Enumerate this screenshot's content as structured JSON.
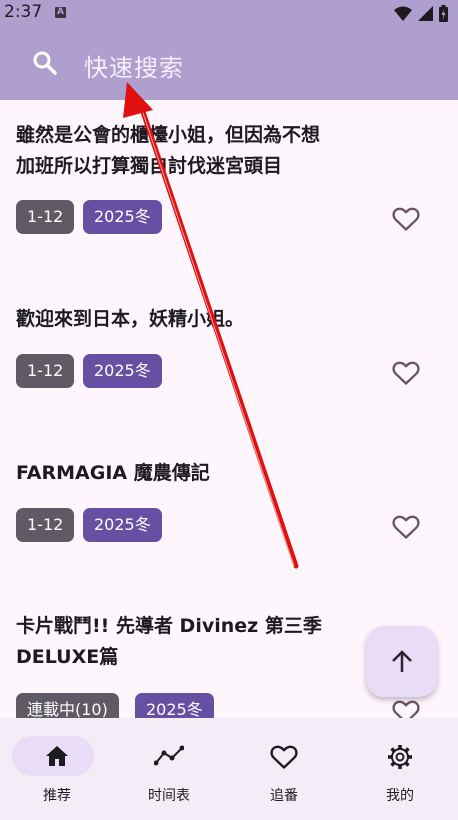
{
  "status": {
    "time": "2:37",
    "a_badge": "A"
  },
  "search": {
    "placeholder": "快速搜索"
  },
  "items": [
    {
      "title": "雖然是公會的櫃檯小姐，但因為不想加班所以打算獨自討伐迷宮頭目",
      "episodes": "1-12",
      "season": "2025冬"
    },
    {
      "title": "歡迎來到日本，妖精小姐。",
      "episodes": "1-12",
      "season": "2025冬"
    },
    {
      "title": "FARMAGIA 魔農傳記",
      "episodes": "1-12",
      "season": "2025冬"
    },
    {
      "title": "卡片戰鬥!! 先導者 Divinez 第三季 DELUXE篇",
      "episodes": "連載中(10)",
      "season": "2025冬"
    }
  ],
  "nav": [
    {
      "label": "推荐",
      "icon": "home-icon"
    },
    {
      "label": "时间表",
      "icon": "timeline-icon"
    },
    {
      "label": "追番",
      "icon": "heart-icon"
    },
    {
      "label": "我的",
      "icon": "gear-icon"
    }
  ],
  "colors": {
    "header": "#ae9fcf",
    "chip_grey": "#5f5a66",
    "chip_purple": "#6750a4",
    "background": "#fdf7fd",
    "navbar": "#f3edf7",
    "annotation_arrow": "#e01010"
  }
}
